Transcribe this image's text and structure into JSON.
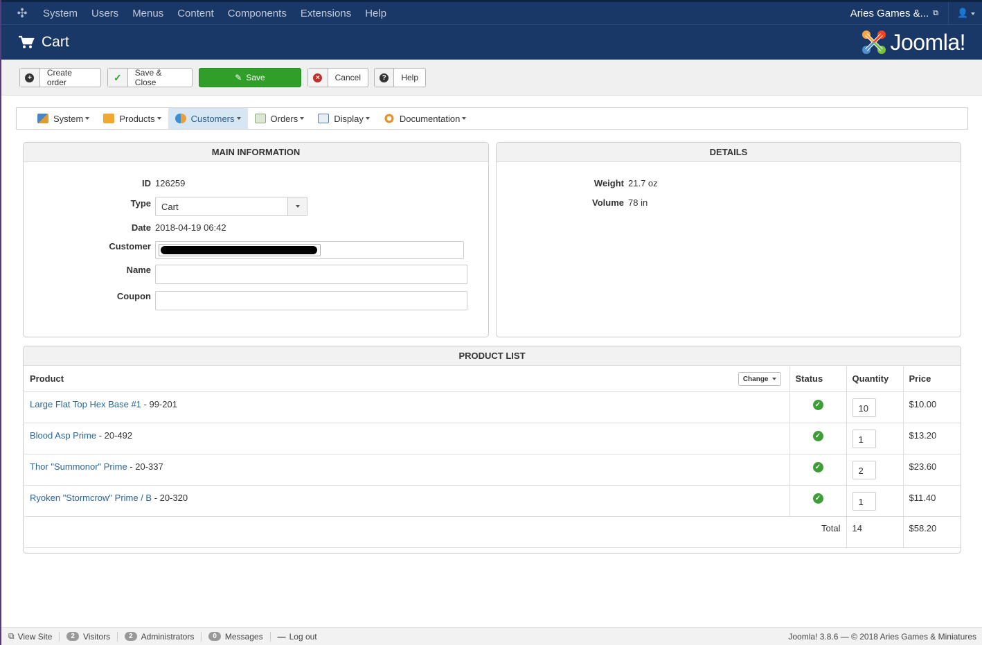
{
  "topnav": {
    "menu": [
      "System",
      "Users",
      "Menus",
      "Content",
      "Components",
      "Extensions",
      "Help"
    ],
    "site_name": "Aries Games &..."
  },
  "header": {
    "title": "Cart",
    "brand": "Joomla!"
  },
  "toolbar": {
    "create_order": "Create order",
    "save_close": "Save & Close",
    "save": "Save",
    "cancel": "Cancel",
    "help": "Help"
  },
  "subnav": {
    "items": [
      "System",
      "Products",
      "Customers",
      "Orders",
      "Display",
      "Documentation"
    ],
    "active": "Customers"
  },
  "main_info": {
    "heading": "MAIN INFORMATION",
    "id_label": "ID",
    "id_value": "126259",
    "type_label": "Type",
    "type_value": "Cart",
    "date_label": "Date",
    "date_value": "2018-04-19 06:42",
    "customer_label": "Customer",
    "name_label": "Name",
    "name_value": "",
    "coupon_label": "Coupon",
    "coupon_value": ""
  },
  "details": {
    "heading": "DETAILS",
    "weight_label": "Weight",
    "weight_value": "21.7 oz",
    "volume_label": "Volume",
    "volume_value": "78 in"
  },
  "product_list": {
    "heading": "PRODUCT LIST",
    "columns": {
      "product": "Product",
      "change": "Change",
      "status": "Status",
      "quantity": "Quantity",
      "price": "Price"
    },
    "rows": [
      {
        "name": "Large Flat Top Hex Base #1",
        "sku": " - 99-201",
        "qty": "10",
        "price": "$10.00"
      },
      {
        "name": "Blood Asp Prime",
        "sku": " - 20-492",
        "qty": "1",
        "price": "$13.20"
      },
      {
        "name": "Thor \"Summonor\" Prime",
        "sku": " - 20-337",
        "qty": "2",
        "price": "$23.60"
      },
      {
        "name": "Ryoken \"Stormcrow\" Prime / B",
        "sku": " - 20-320",
        "qty": "1",
        "price": "$11.40"
      }
    ],
    "total_label": "Total",
    "total_qty": "14",
    "total_price": "$58.20"
  },
  "statusbar": {
    "view_site": "View Site",
    "visitors_count": "2",
    "visitors": "Visitors",
    "admins_count": "2",
    "admins": "Administrators",
    "messages_count": "0",
    "messages": "Messages",
    "logout": "Log out",
    "copyright": "Joomla! 3.8.6 — © 2018 Aries Games & Miniatures"
  },
  "colors": {
    "navbar": "#1a3867",
    "save_green": "#2f9f2a",
    "link": "#2a6496",
    "status_ok": "#3e9d37"
  }
}
